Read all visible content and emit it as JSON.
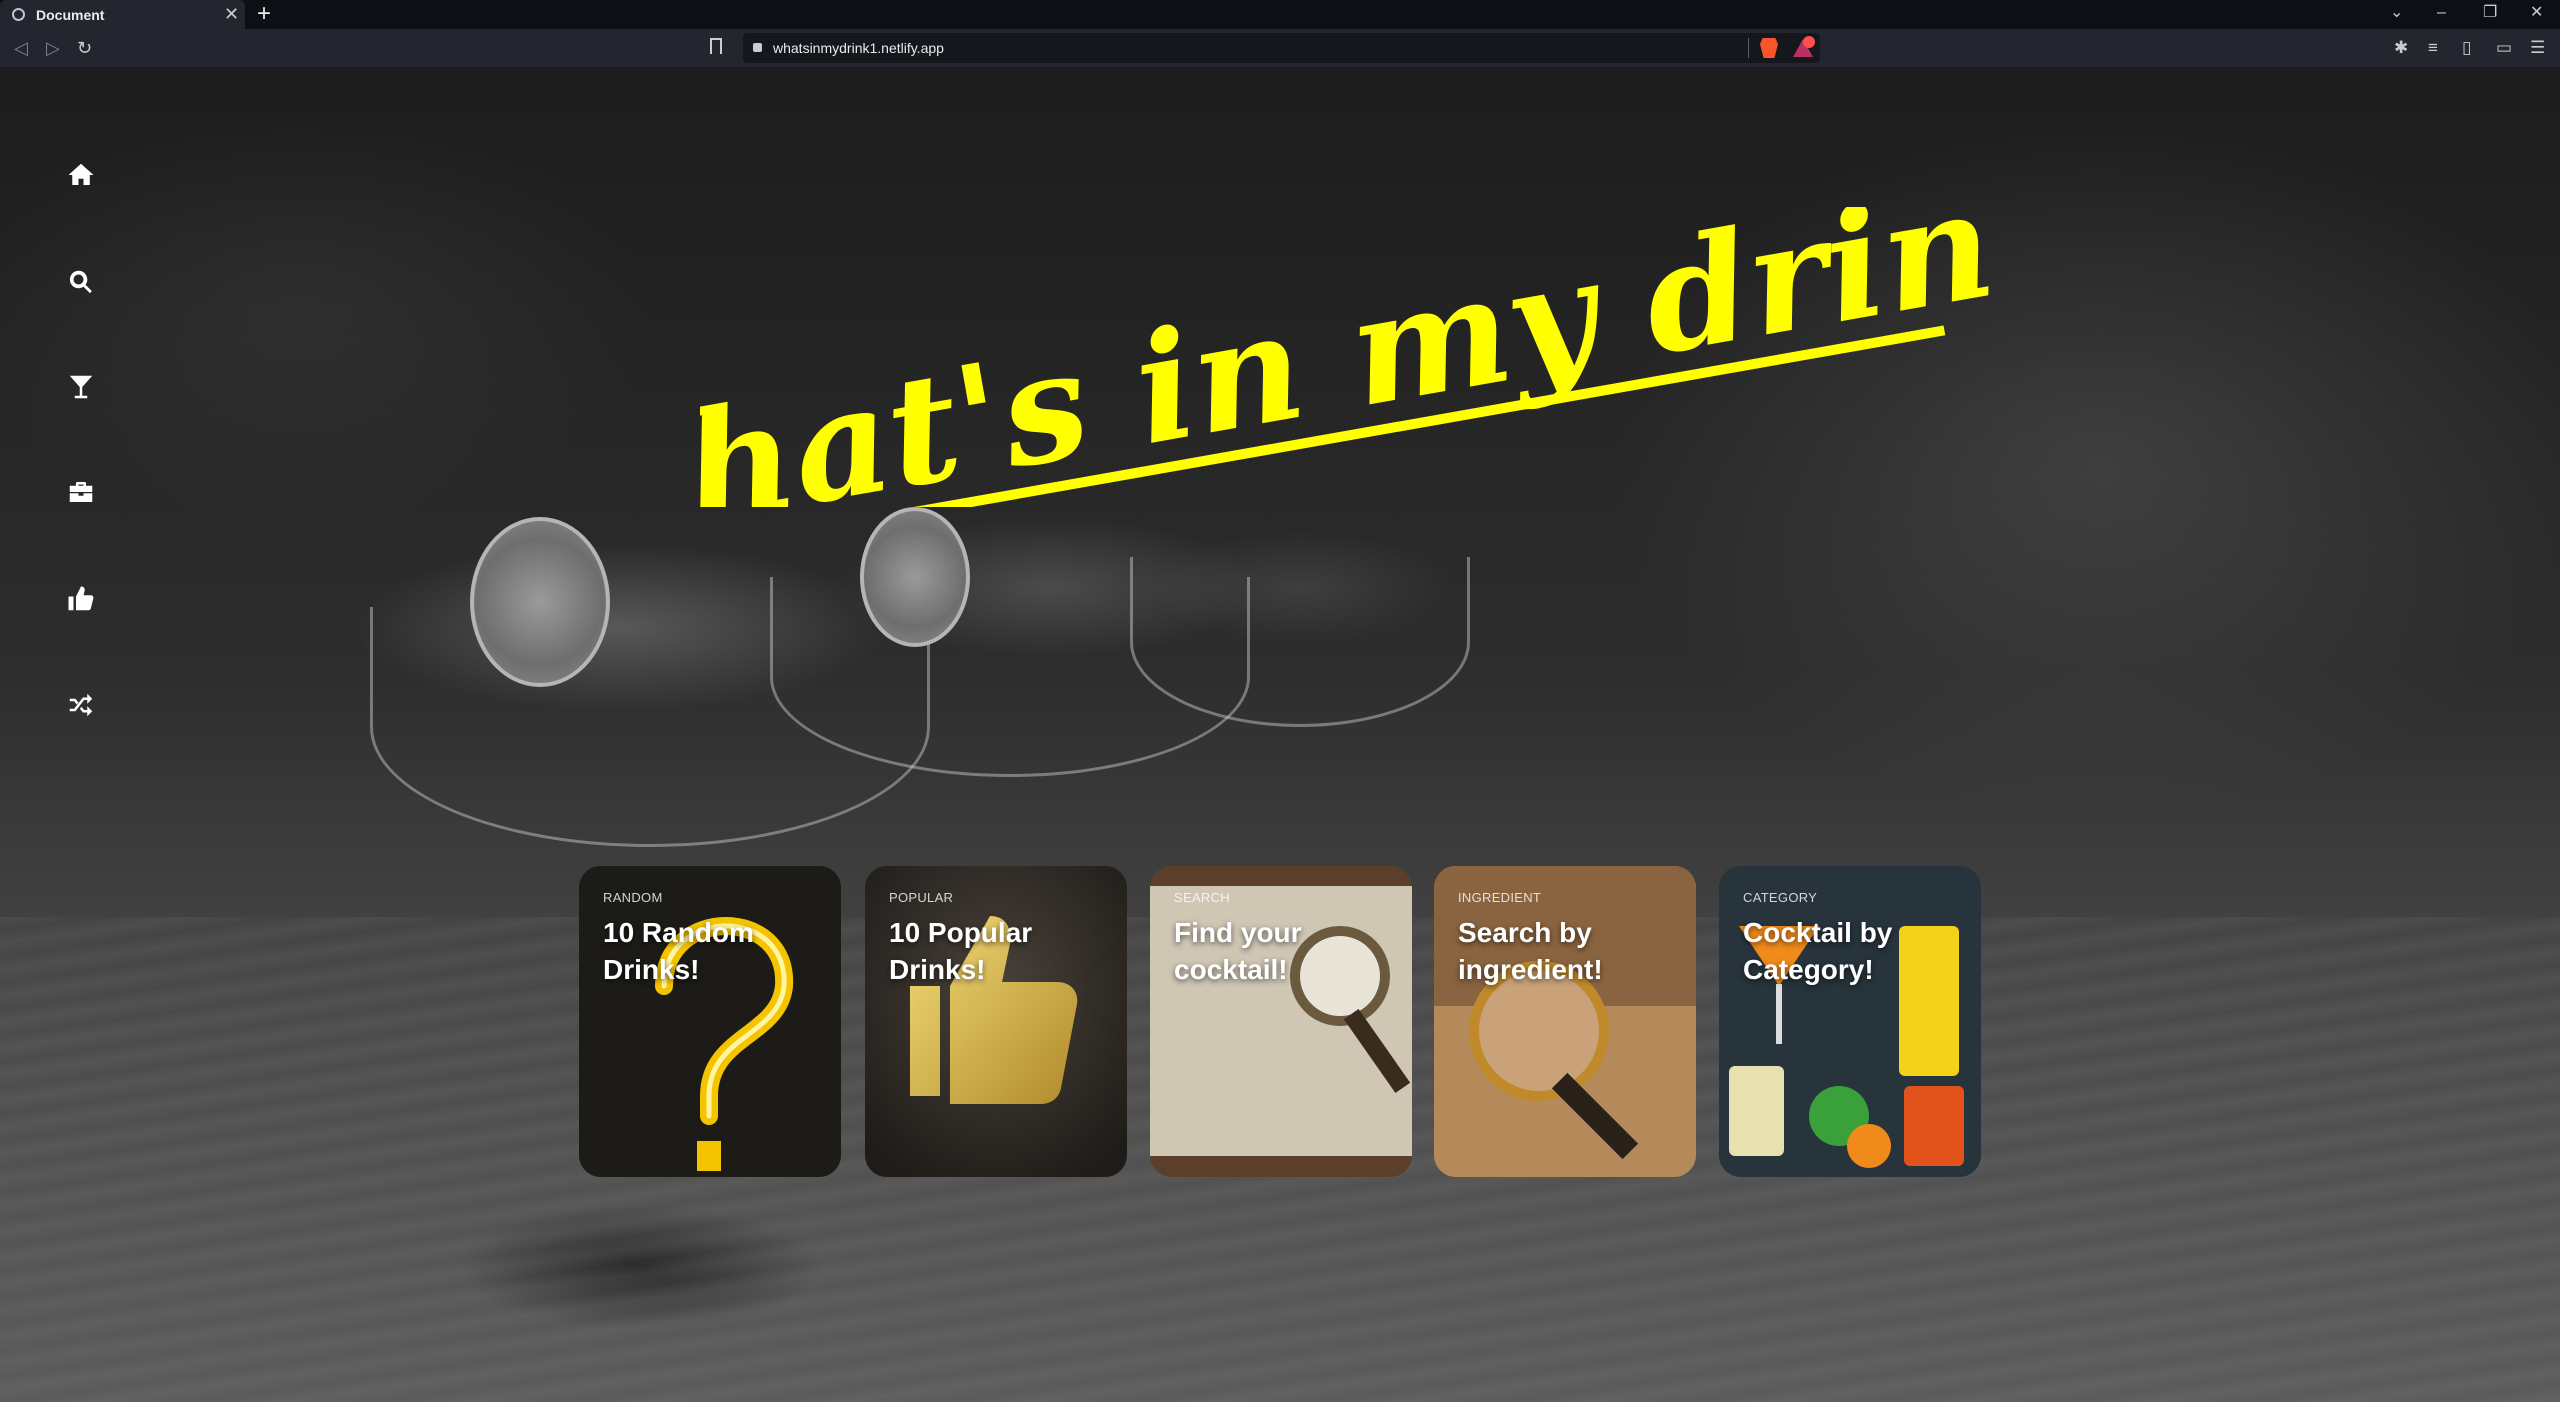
{
  "browser": {
    "tab_title": "Document",
    "new_tab": "+",
    "tab_close": "✕",
    "url": "whatsinmydrink1.netlify.app",
    "nav": {
      "back": "◁",
      "forward": "▷",
      "reload": "↻"
    },
    "window_controls": {
      "tabs_menu": "⌄",
      "minimize": "–",
      "restore": "❐",
      "close": "✕"
    },
    "toolbar_icons": {
      "extensions": "✱",
      "playlist": "≡",
      "sidebar": "▯",
      "wallet": "▭",
      "menu": "☰"
    }
  },
  "sidebar": {
    "items": [
      {
        "name": "home",
        "icon": "home-icon"
      },
      {
        "name": "search",
        "icon": "search-icon"
      },
      {
        "name": "cocktail",
        "icon": "cocktail-glass-icon"
      },
      {
        "name": "ingredients",
        "icon": "briefcase-icon"
      },
      {
        "name": "popular",
        "icon": "thumbs-up-icon"
      },
      {
        "name": "random",
        "icon": "shuffle-icon"
      }
    ]
  },
  "hero": {
    "title": "What's in my drink?",
    "color": "#ffff00"
  },
  "cards": [
    {
      "kind": "RANDOM",
      "label": "10 Random Drinks!",
      "art": "neon-question-mark"
    },
    {
      "kind": "POPULAR",
      "label": "10 Popular Drinks!",
      "art": "gold-thumbs-up"
    },
    {
      "kind": "SEARCH",
      "label": "Find your cocktail!",
      "art": "magnifying-glass-on-paper"
    },
    {
      "kind": "INGREDIENT",
      "label": "Search by ingredient!",
      "art": "magnifying-glass-on-text"
    },
    {
      "kind": "CATEGORY",
      "label": "Cocktail by Category!",
      "art": "colorful-cocktails"
    }
  ]
}
